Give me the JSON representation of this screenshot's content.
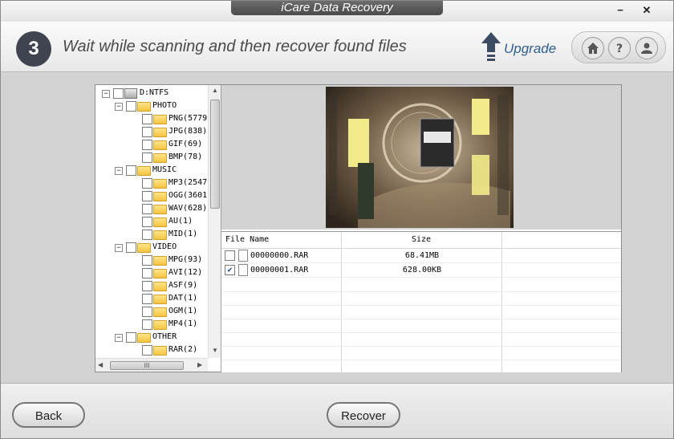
{
  "window": {
    "title": "iCare Data Recovery",
    "minimize_label": "−",
    "close_label": "✕"
  },
  "header": {
    "step_number": "3",
    "step_text": "Wait while scanning and then recover found files",
    "upgrade_label": "Upgrade",
    "icons": [
      "home-icon",
      "help-icon",
      "user-icon"
    ]
  },
  "tree": {
    "nodes": [
      {
        "label": "D:NTFS",
        "level": 0,
        "kind": "drive"
      },
      {
        "label": "PHOTO",
        "level": 1,
        "kind": "folder"
      },
      {
        "label": "PNG(5779",
        "level": 2,
        "kind": "folder"
      },
      {
        "label": "JPG(838)",
        "level": 2,
        "kind": "folder"
      },
      {
        "label": "GIF(69)",
        "level": 2,
        "kind": "folder"
      },
      {
        "label": "BMP(78)",
        "level": 2,
        "kind": "folder"
      },
      {
        "label": "MUSIC",
        "level": 1,
        "kind": "folder"
      },
      {
        "label": "MP3(2547",
        "level": 2,
        "kind": "folder"
      },
      {
        "label": "OGG(3601",
        "level": 2,
        "kind": "folder"
      },
      {
        "label": "WAV(628)",
        "level": 2,
        "kind": "folder"
      },
      {
        "label": "AU(1)",
        "level": 2,
        "kind": "folder"
      },
      {
        "label": "MID(1)",
        "level": 2,
        "kind": "folder"
      },
      {
        "label": "VIDEO",
        "level": 1,
        "kind": "folder"
      },
      {
        "label": "MPG(93)",
        "level": 2,
        "kind": "folder"
      },
      {
        "label": "AVI(12)",
        "level": 2,
        "kind": "folder"
      },
      {
        "label": "ASF(9)",
        "level": 2,
        "kind": "folder"
      },
      {
        "label": "DAT(1)",
        "level": 2,
        "kind": "folder"
      },
      {
        "label": "OGM(1)",
        "level": 2,
        "kind": "folder"
      },
      {
        "label": "MP4(1)",
        "level": 2,
        "kind": "folder"
      },
      {
        "label": "OTHER",
        "level": 1,
        "kind": "folder"
      },
      {
        "label": "RAR(2)",
        "level": 2,
        "kind": "folder"
      }
    ],
    "hscroll_grip": "III"
  },
  "files": {
    "columns": [
      "File Name",
      "Size"
    ],
    "rows": [
      {
        "name": "00000000.RAR",
        "size": "68.41MB",
        "checked": false
      },
      {
        "name": "00000001.RAR",
        "size": "628.00KB",
        "checked": true
      }
    ]
  },
  "footer": {
    "back_label": "Back",
    "recover_label": "Recover"
  },
  "colors": {
    "step_circle": "#3f4450",
    "upgrade_text": "#2f5f8f",
    "title_tab": "#555555"
  }
}
